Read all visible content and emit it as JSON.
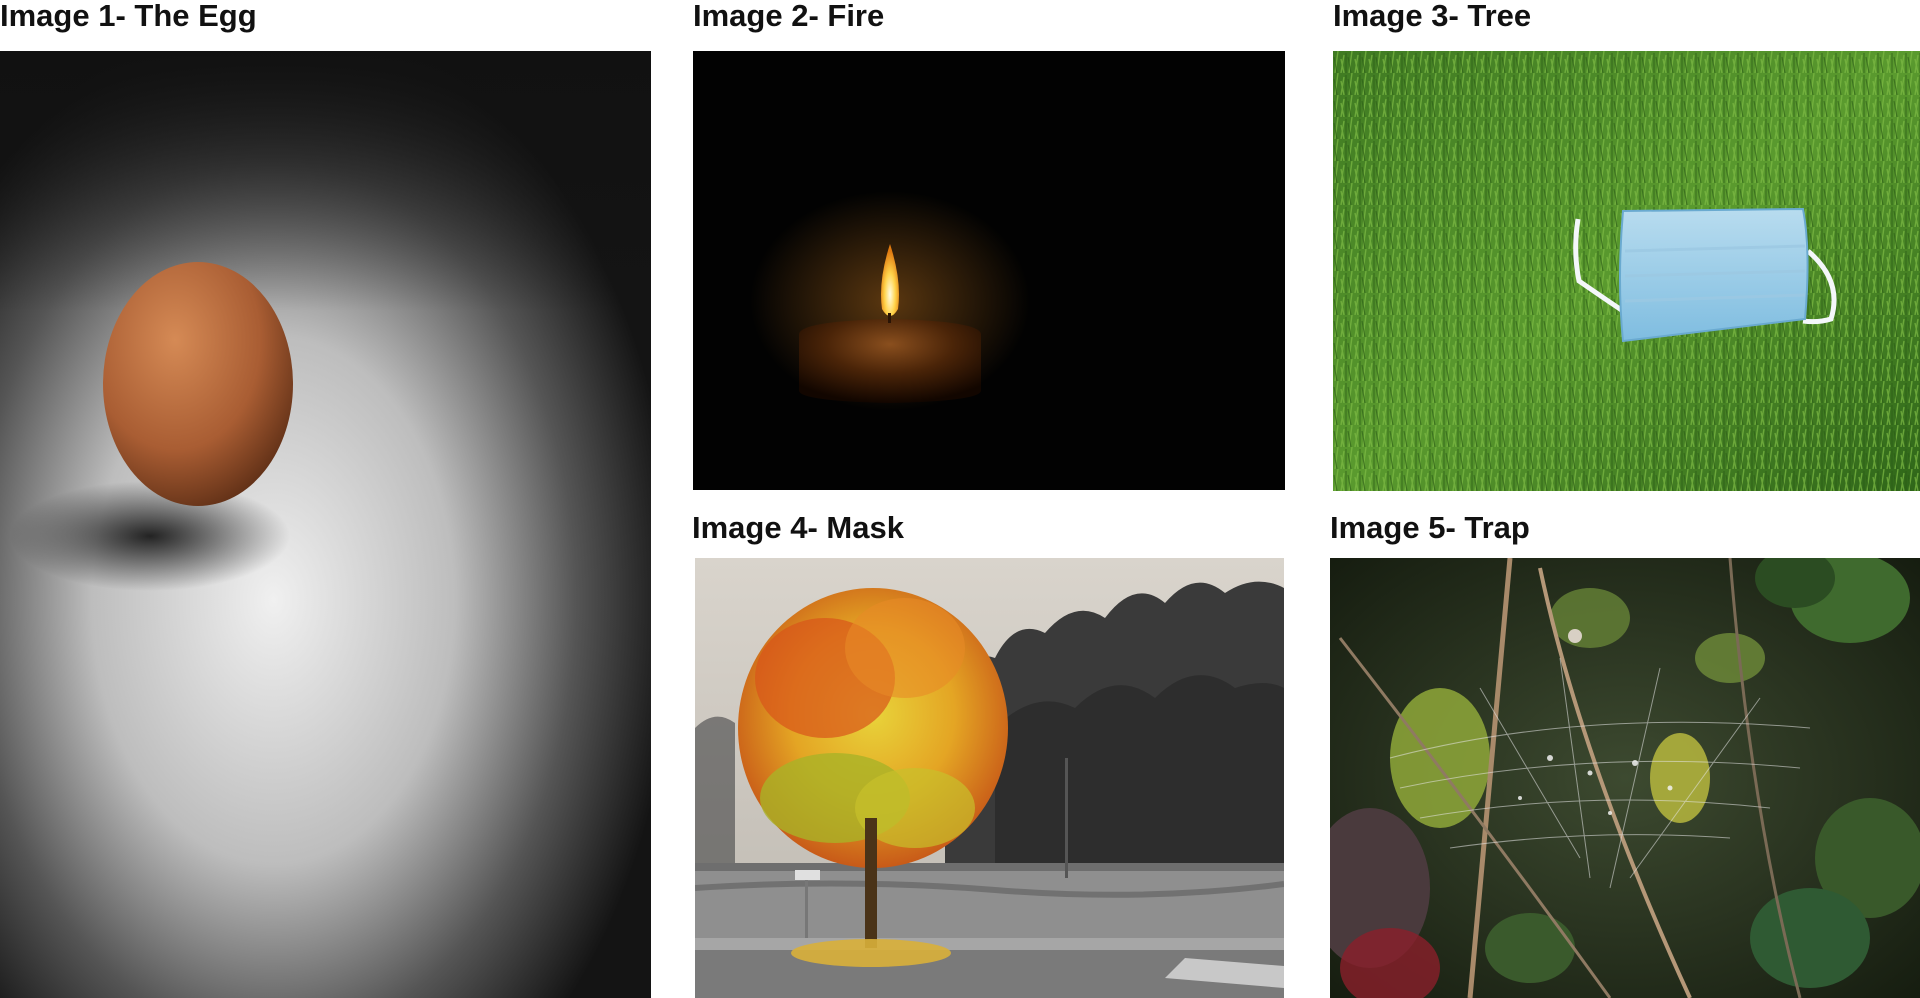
{
  "panels": [
    {
      "id": "egg",
      "caption": "Image 1- The Egg"
    },
    {
      "id": "fire",
      "caption": "Image 2- Fire"
    },
    {
      "id": "tree",
      "caption": "Image 3- Tree"
    },
    {
      "id": "mask",
      "caption": "Image 4- Mask"
    },
    {
      "id": "trap",
      "caption": "Image 5- Trap"
    }
  ],
  "colors": {
    "page_background": "#ffffff",
    "caption_text": "#111111"
  }
}
